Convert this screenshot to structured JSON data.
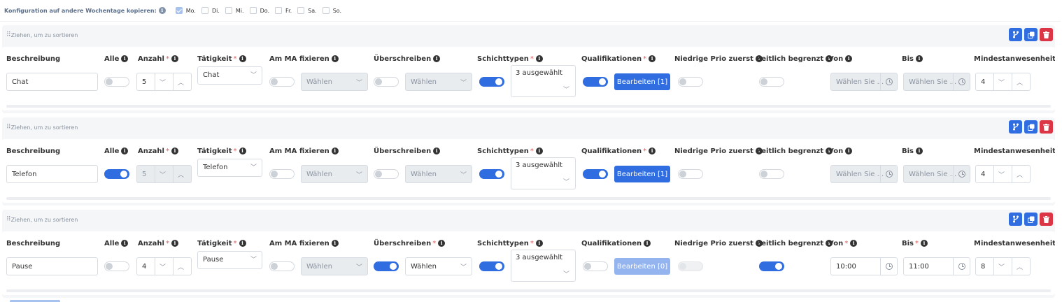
{
  "copy_config": {
    "label": "Konfiguration auf andere Wochentage kopieren:",
    "days": [
      {
        "label": "Mo.",
        "checked": true
      },
      {
        "label": "Di.",
        "checked": false
      },
      {
        "label": "Mi.",
        "checked": false
      },
      {
        "label": "Do.",
        "checked": false
      },
      {
        "label": "Fr.",
        "checked": false
      },
      {
        "label": "Sa.",
        "checked": false
      },
      {
        "label": "So.",
        "checked": false
      }
    ]
  },
  "drag_label": "Ziehen, um zu sortieren",
  "headers": {
    "beschreibung": "Beschreibung",
    "alle": "Alle",
    "anzahl": "Anzahl",
    "taetigkeit": "Tätigkeit",
    "am_ma": "Am MA fixieren",
    "ueberschreiben": "Überschreiben",
    "schichttypen": "Schichttypen",
    "qualifikationen": "Qualifikationen",
    "niedrige_prio": "Niedrige Prio zuerst",
    "zeitlich": "Zeitlich begrenzt",
    "von": "Von",
    "bis": "Bis",
    "mindest": "Mindestanwesenheit (Std"
  },
  "required_mark": "*",
  "info_glyph": "i",
  "icons": {
    "branch": "branch-icon",
    "copy": "copy-icon",
    "trash": "trash-icon",
    "clock": "clock-icon",
    "chevron_down": "chevron-down-icon",
    "chevron_up": "chevron-up-icon",
    "grip": "drag-handle-icon"
  },
  "colors": {
    "primary": "#2f6de1",
    "danger": "#dc3545",
    "required": "#e05a5a"
  },
  "rows": [
    {
      "beschreibung": "Chat",
      "alle": false,
      "anzahl": "5",
      "taetigkeit": "Chat",
      "am_ma": false,
      "am_ma_select": "Wählen",
      "ueberschreiben": false,
      "ueberschreiben_select": "Wählen",
      "schichttypen_on": true,
      "schichttypen": "3 ausgewählt",
      "qualifikationen_on": true,
      "qualifikationen_btn": "Bearbeiten [1]",
      "niedrige_prio": false,
      "zeitlich": false,
      "von": "Wählen Sie ...",
      "bis": "Wählen Sie ...",
      "mindest": "4"
    },
    {
      "beschreibung": "Telefon",
      "alle": true,
      "anzahl": "5",
      "taetigkeit": "Telefon",
      "am_ma": false,
      "am_ma_select": "Wählen",
      "ueberschreiben": false,
      "ueberschreiben_select": "Wählen",
      "schichttypen_on": true,
      "schichttypen": "3 ausgewählt",
      "qualifikationen_on": true,
      "qualifikationen_btn": "Bearbeiten [1]",
      "niedrige_prio": false,
      "zeitlich": false,
      "von": "Wählen Sie ...",
      "bis": "Wählen Sie ...",
      "mindest": "4"
    },
    {
      "beschreibung": "Pause",
      "alle": false,
      "anzahl": "4",
      "taetigkeit": "Pause",
      "am_ma": false,
      "am_ma_select": "Wählen",
      "ueberschreiben": true,
      "ueberschreiben_select": "Wählen",
      "schichttypen_on": true,
      "schichttypen": "3 ausgewählt",
      "qualifikationen_on": false,
      "qualifikationen_btn": "Bearbeiten [0]",
      "niedrige_prio": false,
      "zeitlich": true,
      "von": "10:00",
      "bis": "11:00",
      "mindest": "8"
    }
  ]
}
